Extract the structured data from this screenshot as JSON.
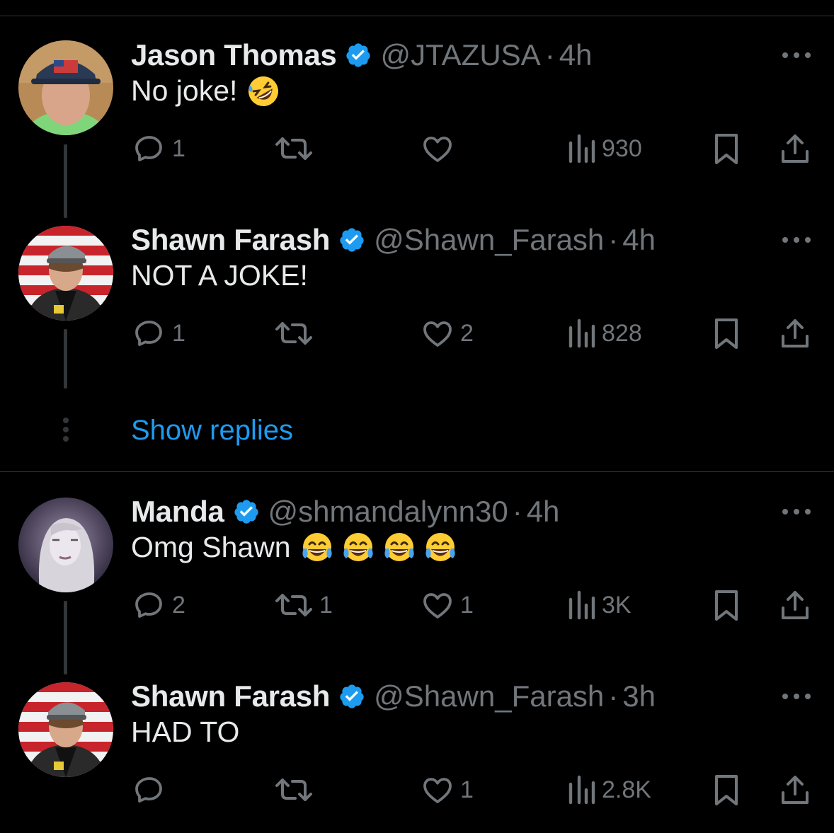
{
  "tweets": [
    {
      "name": "Jason Thomas",
      "handle": "@JTAZUSA",
      "separator": "·",
      "time": "4h",
      "text": "No joke!",
      "emoji": [
        "rolling-on-floor-laughing"
      ],
      "replies": "1",
      "reposts": "",
      "likes": "",
      "views": "930"
    },
    {
      "name": "Shawn Farash",
      "handle": "@Shawn_Farash",
      "separator": "·",
      "time": "4h",
      "text": "NOT A JOKE!",
      "emoji": [],
      "replies": "1",
      "reposts": "",
      "likes": "2",
      "views": "828"
    },
    {
      "name": "Manda",
      "handle": "@shmandalynn30",
      "separator": "·",
      "time": "4h",
      "text": "Omg Shawn",
      "emoji": [
        "tears-of-joy",
        "tears-of-joy",
        "tears-of-joy",
        "tears-of-joy"
      ],
      "replies": "2",
      "reposts": "1",
      "likes": "1",
      "views": "3K"
    },
    {
      "name": "Shawn Farash",
      "handle": "@Shawn_Farash",
      "separator": "·",
      "time": "3h",
      "text": "HAD TO",
      "emoji": [],
      "replies": "",
      "reposts": "",
      "likes": "1",
      "views": "2.8K"
    }
  ],
  "show_replies_label": "Show replies",
  "colors": {
    "background": "#000000",
    "text": "#e7e9ea",
    "muted": "#71767b",
    "accent": "#1d9bf0",
    "divider": "#2f3336",
    "thread_line": "#333639"
  },
  "icons": [
    "verified-badge-icon",
    "more-icon",
    "reply-icon",
    "repost-icon",
    "like-icon",
    "views-icon",
    "bookmark-icon",
    "share-icon",
    "thread-dots-icon"
  ]
}
